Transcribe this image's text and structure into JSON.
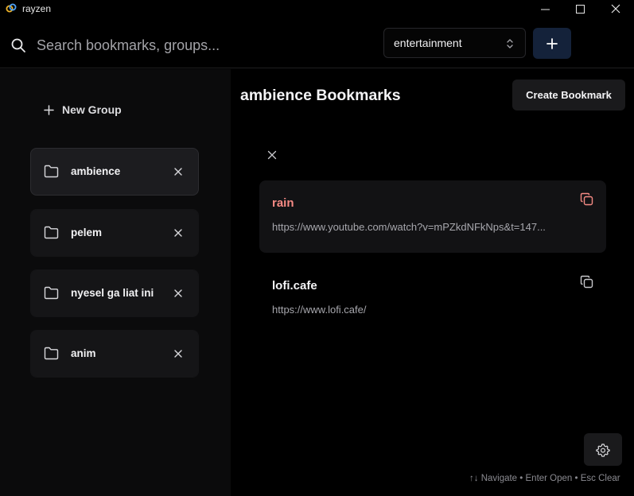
{
  "window": {
    "title": "rayzen",
    "logo_icon": "link-logo-icon"
  },
  "search": {
    "placeholder": "Search bookmarks, groups...",
    "value": ""
  },
  "group_selector": {
    "selected": "entertainment"
  },
  "sidebar": {
    "new_group_label": "New Group",
    "groups": [
      {
        "label": "ambience",
        "active": true
      },
      {
        "label": "pelem",
        "active": false
      },
      {
        "label": "nyesel ga liat ini",
        "active": false
      },
      {
        "label": "anim",
        "active": false
      }
    ]
  },
  "main": {
    "title": "ambience Bookmarks",
    "create_button_label": "Create Bookmark",
    "bookmarks": [
      {
        "title": "rain",
        "url": "https://www.youtube.com/watch?v=mPZkdNFkNps&t=147...",
        "selected": true
      },
      {
        "title": "lofi.cafe",
        "url": "https://www.lofi.cafe/",
        "selected": false
      }
    ],
    "footer_hint": "↑↓ Navigate • Enter Open • Esc Clear"
  },
  "colors": {
    "accent_red": "#f58a84",
    "add_button_bg": "#14223a",
    "sidebar_bg": "#0b0b0c",
    "background": "#000000"
  }
}
